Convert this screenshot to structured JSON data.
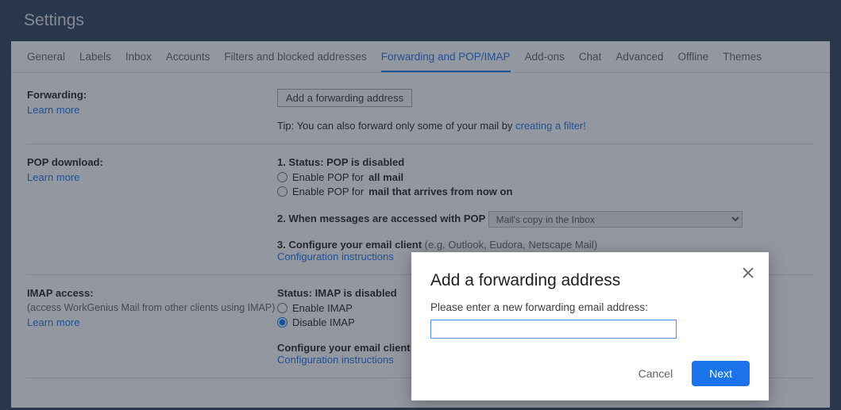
{
  "header": {
    "title": "Settings"
  },
  "tabs": {
    "general": "General",
    "labels": "Labels",
    "inbox": "Inbox",
    "accounts": "Accounts",
    "filters": "Filters and blocked addresses",
    "fwd": "Forwarding and POP/IMAP",
    "addons": "Add-ons",
    "chat": "Chat",
    "advanced": "Advanced",
    "offline": "Offline",
    "themes": "Themes"
  },
  "forwarding": {
    "title": "Forwarding:",
    "learn_more": "Learn more",
    "add_btn": "Add a forwarding address",
    "tip_prefix": "Tip: You can also forward only some of your mail by ",
    "tip_link": "creating a filter!"
  },
  "pop": {
    "title": "POP download:",
    "learn_more": "Learn more",
    "status_num": "1. ",
    "status_label": "Status: ",
    "status_value": "POP is disabled",
    "opt1_prefix": "Enable POP for ",
    "opt1_bold": "all mail",
    "opt2_prefix": "Enable POP for ",
    "opt2_bold": "mail that arrives from now on",
    "step2_prefix": "2. When messages are accessed with POP ",
    "dropdown_value": "Mail's copy in the Inbox",
    "step3_prefix": "3. Configure your email client ",
    "step3_example": "(e.g. Outlook, Eudora, Netscape Mail)",
    "cfg_link": "Configuration instructions"
  },
  "imap": {
    "title": "IMAP access:",
    "subtitle": "(access WorkGenius Mail from other clients using IMAP)",
    "learn_more": "Learn more",
    "status_label": "Status: ",
    "status_value": "IMAP is disabled",
    "opt_enable": "Enable IMAP",
    "opt_disable": "Disable IMAP",
    "cfg_prefix": "Configure your email client ",
    "cfg_paren": "(",
    "cfg_link": "Configuration instructions"
  },
  "dialog": {
    "title": "Add a forwarding address",
    "prompt": "Please enter a new forwarding email address:",
    "cancel": "Cancel",
    "next": "Next",
    "input_value": ""
  }
}
